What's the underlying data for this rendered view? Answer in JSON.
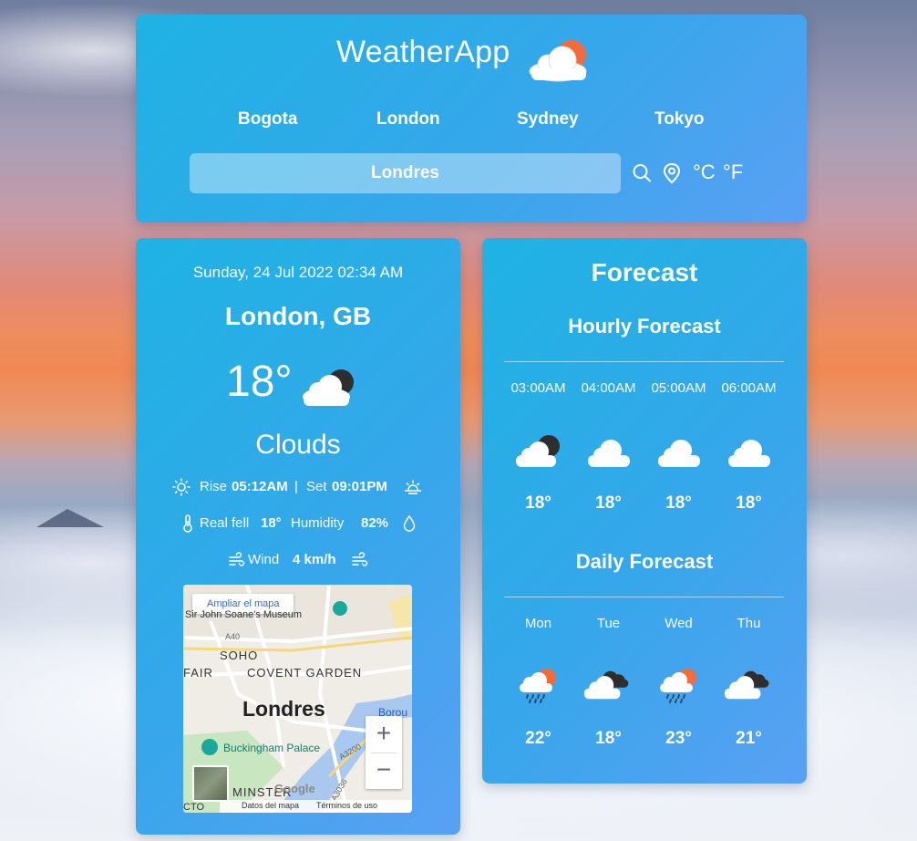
{
  "header": {
    "title": "WeatherApp",
    "logo_icon": "sun-cloud-icon",
    "cities": [
      "Bogota",
      "London",
      "Sydney",
      "Tokyo"
    ],
    "search_value": "Londres",
    "search_icon": "search-icon",
    "location_icon": "location-pin-icon",
    "unit_c": "°C",
    "unit_f": "°F"
  },
  "current": {
    "datetime": "Sunday, 24 Jul 2022 02:34 AM",
    "location": "London, GB",
    "temperature": "18°",
    "icon": "moon-cloud-icon",
    "condition": "Clouds",
    "rise_label": "Rise",
    "rise_time": "05:12AM",
    "separator": "|",
    "set_label": "Set",
    "set_time": "09:01PM",
    "realfeel_label": "Real fell",
    "realfeel_value": "18°",
    "humidity_label": "Humidity",
    "humidity_value": "82%",
    "wind_label": "Wind",
    "wind_value": "4 km/h"
  },
  "map": {
    "enlarge_label": "Ampliar el mapa",
    "labels": {
      "museum": "Sir John Soane's Museum",
      "soho": "SOHO",
      "fair": "FAIR",
      "covent": "COVENT GARDEN",
      "city": "Londres",
      "boro": "Borou",
      "palace": "Buckingham Palace",
      "minster": "MINSTER",
      "road_a40": "A40",
      "road_a3200": "A3200",
      "road_a3036": "A3036",
      "google": "Google",
      "cto": "CTO"
    },
    "zoom_in": "+",
    "zoom_out": "−",
    "footer_data": "Datos del mapa",
    "footer_terms": "Términos de uso"
  },
  "forecast": {
    "title": "Forecast",
    "hourly_title": "Hourly Forecast",
    "hourly": [
      {
        "time": "03:00AM",
        "icon": "moon-cloud-icon",
        "temp": "18°"
      },
      {
        "time": "04:00AM",
        "icon": "cloud-icon",
        "temp": "18°"
      },
      {
        "time": "05:00AM",
        "icon": "cloud-icon",
        "temp": "18°"
      },
      {
        "time": "06:00AM",
        "icon": "cloud-icon",
        "temp": "18°"
      }
    ],
    "daily_title": "Daily Forecast",
    "daily": [
      {
        "day": "Mon",
        "icon": "sun-rain-icon",
        "temp": "22°"
      },
      {
        "day": "Tue",
        "icon": "dark-clouds-icon",
        "temp": "18°"
      },
      {
        "day": "Wed",
        "icon": "sun-rain-icon",
        "temp": "23°"
      },
      {
        "day": "Thu",
        "icon": "dark-clouds-icon",
        "temp": "21°"
      }
    ]
  },
  "colors": {
    "panel_start": "#1fb3e3",
    "panel_end": "#5aa0f4",
    "sun": "#f26b3a",
    "moon": "#333333"
  }
}
